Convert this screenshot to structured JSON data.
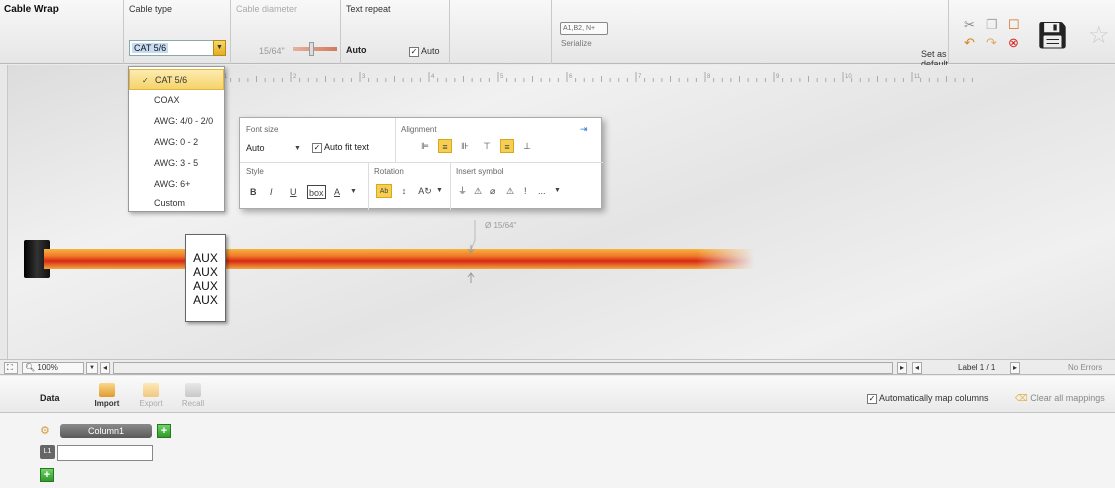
{
  "toolbar": {
    "app_title": "Cable Wrap",
    "cable_type_label": "Cable type",
    "cable_type_value": "CAT 5/6",
    "cable_diameter_label": "Cable diameter",
    "cable_diameter_value": "15/64\"",
    "text_repeat_label": "Text repeat",
    "text_repeat_value": "Auto",
    "auto_checkbox_label": "Auto",
    "set_default_label": "Set as default",
    "serialize_icon_text": "A1,B2, N+",
    "serialize_label": "Serialize"
  },
  "dropdown": {
    "items": [
      "CAT 5/6",
      "COAX",
      "AWG: 4/0 - 2/0",
      "AWG: 0 - 2",
      "AWG: 3 - 5",
      "AWG: 6+",
      "Custom"
    ],
    "selected_index": 0
  },
  "format_panel": {
    "font_size_label": "Font size",
    "font_size_value": "Auto",
    "auto_fit_label": "Auto fit text",
    "alignment_label": "Alignment",
    "style_label": "Style",
    "rotation_label": "Rotation",
    "insert_symbol_label": "Insert symbol",
    "style_buttons": [
      "B",
      "I",
      "U",
      "box",
      "A"
    ],
    "symbol_buttons": [
      "⏚",
      "⚠",
      "⌀",
      "⚠",
      "!",
      "..."
    ]
  },
  "label": {
    "lines": [
      "AUX",
      "AUX",
      "AUX",
      "AUX"
    ]
  },
  "canvas": {
    "diameter_annotation": "Ø 15/64\"",
    "ruler_marks": [
      "1",
      "2",
      "3",
      "4",
      "5",
      "6",
      "7",
      "8",
      "9",
      "10",
      "11"
    ]
  },
  "statusbar": {
    "zoom": "100%",
    "label_counter": "Label 1 / 1",
    "errors": "No Errors"
  },
  "datapanel": {
    "title": "Data",
    "import_label": "Import",
    "export_label": "Export",
    "recall_label": "Recall",
    "auto_map_label": "Automatically map columns",
    "clear_map_label": "Clear all mappings",
    "column_name": "Column1",
    "row_id": "L1",
    "cell_value": ""
  },
  "colors": {
    "accent_yellow": "#f7cf50",
    "cable_red": "#d83a1a",
    "cable_orange": "#f0a030",
    "add_green": "#3aa535"
  }
}
